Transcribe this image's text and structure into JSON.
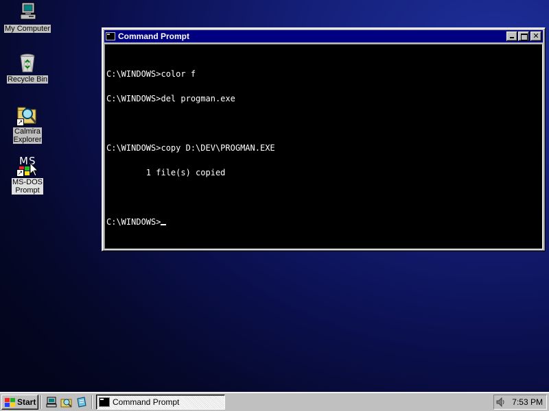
{
  "desktop": {
    "icons": [
      {
        "label": "My Computer"
      },
      {
        "label": "Recycle Bin"
      },
      {
        "label": "Calmira\nExplorer"
      },
      {
        "label": "MS-DOS\nPrompt",
        "glyph_text": "MS"
      }
    ]
  },
  "window": {
    "title": "Command Prompt",
    "console_lines": [
      "C:\\WINDOWS>color f",
      "C:\\WINDOWS>del progman.exe",
      "",
      "C:\\WINDOWS>copy D:\\DEV\\PROGMAN.EXE",
      "        1 file(s) copied",
      "",
      "C:\\WINDOWS>"
    ]
  },
  "taskbar": {
    "start_label": "Start",
    "tasks": [
      {
        "label": "Command Prompt"
      }
    ],
    "clock": "7:53 PM"
  },
  "colors": {
    "titlebar": "#000080",
    "chrome": "#c0c0c0",
    "console_bg": "#000000",
    "console_fg": "#ffffff"
  }
}
